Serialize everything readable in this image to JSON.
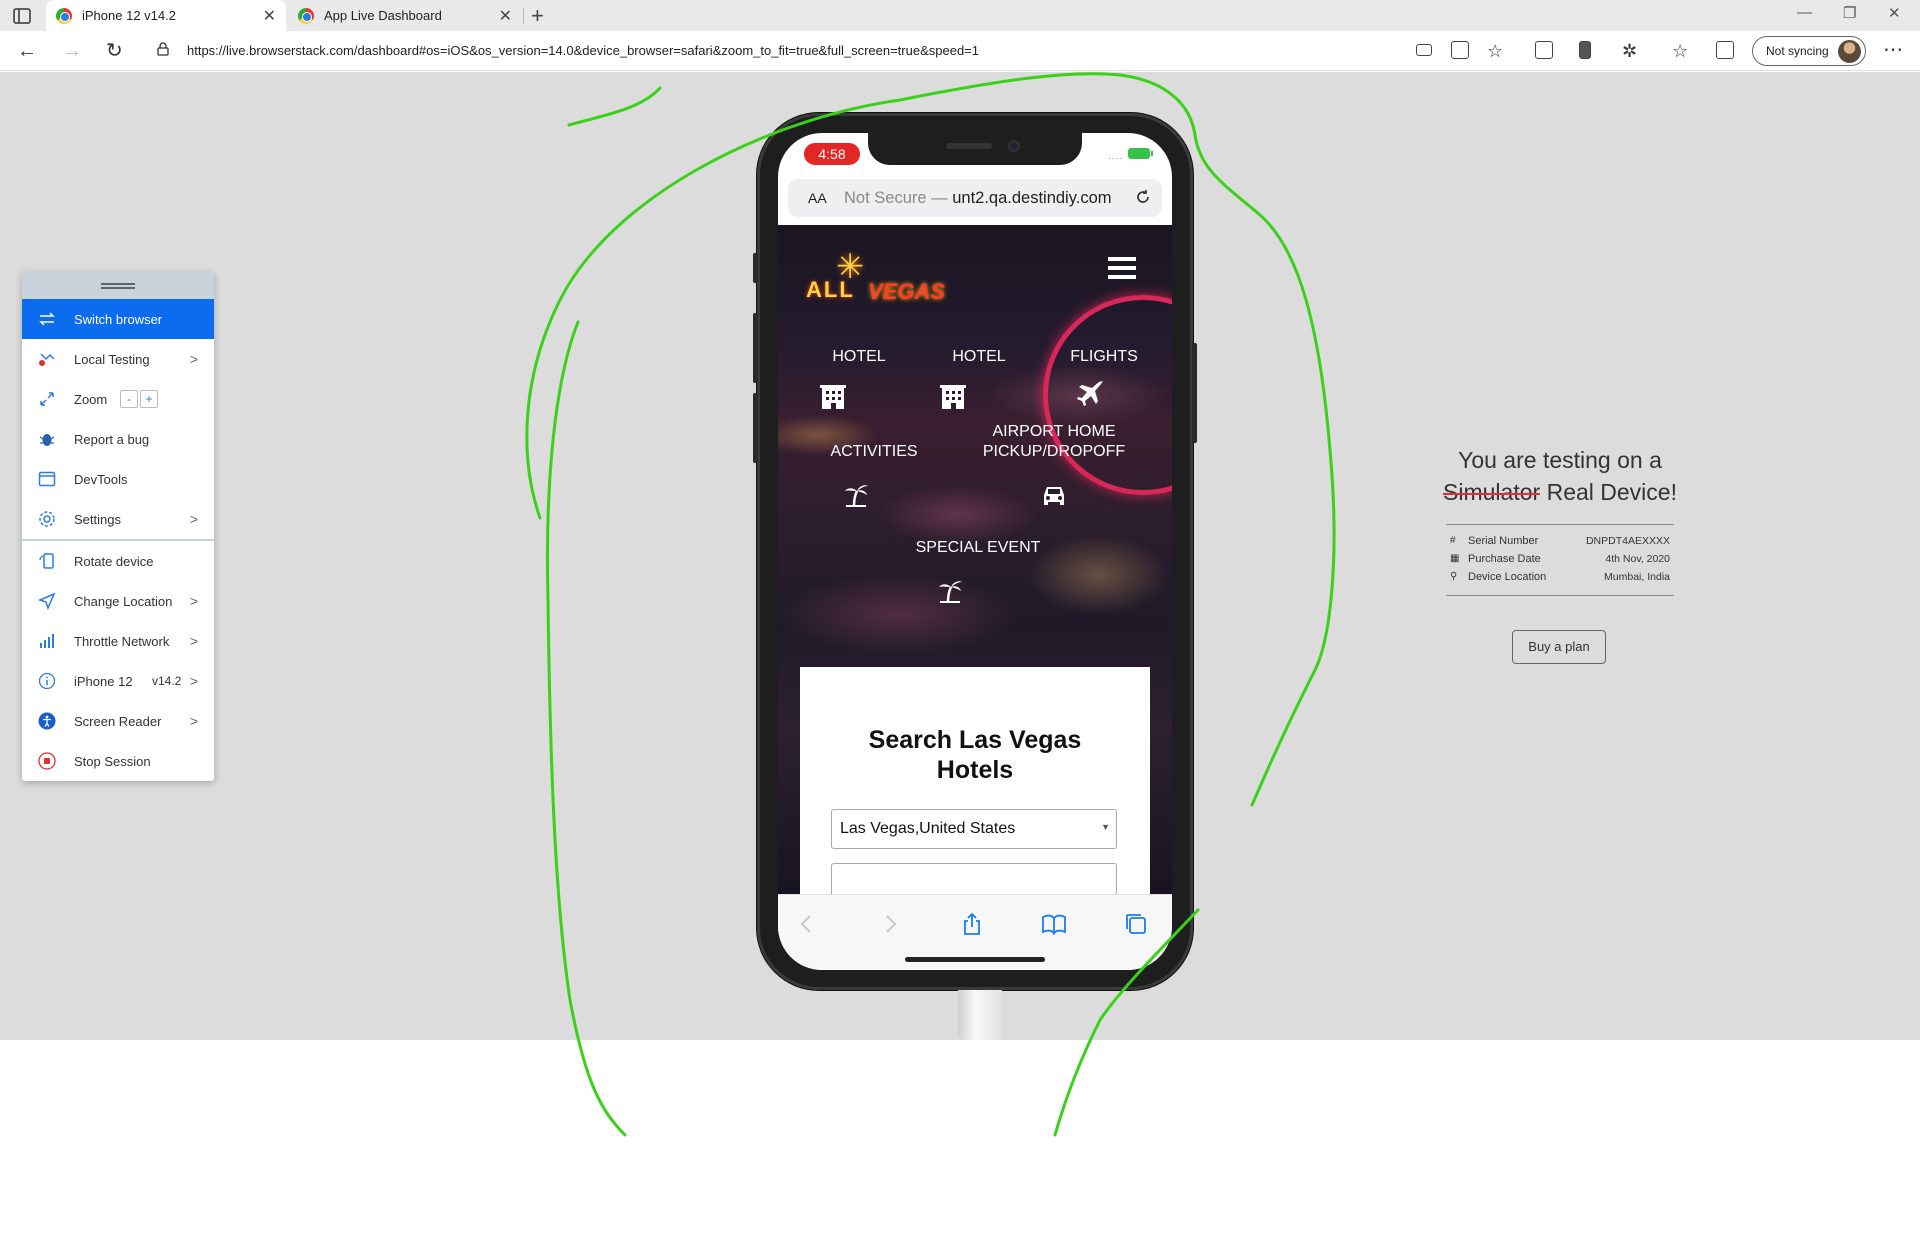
{
  "browser": {
    "tabs": [
      {
        "label": "iPhone 12 v14.2",
        "active": true
      },
      {
        "label": "App Live Dashboard",
        "active": false
      }
    ],
    "url": "https://live.browserstack.com/dashboard#os=iOS&os_version=14.0&device_browser=safari&zoom_to_fit=true&full_screen=true&speed=1",
    "sync_label": "Not syncing"
  },
  "toolbar": {
    "items": [
      {
        "label": "Switch browser",
        "icon": "switch-icon",
        "active": true
      },
      {
        "label": "Local Testing",
        "icon": "local-testing-icon",
        "chevron": ">"
      },
      {
        "label": "Zoom",
        "icon": "expand-icon",
        "minus": "-",
        "plus": "+"
      },
      {
        "label": "Report a bug",
        "icon": "bug-icon"
      },
      {
        "label": "DevTools",
        "icon": "devtools-icon"
      },
      {
        "label": "Settings",
        "icon": "gear-icon",
        "chevron": ">"
      },
      {
        "label": "Rotate device",
        "icon": "rotate-icon"
      },
      {
        "label": "Change Location",
        "icon": "location-arrow-icon",
        "chevron": ">"
      },
      {
        "label": "Throttle Network",
        "icon": "signal-bars-icon",
        "chevron": ">"
      },
      {
        "label": "iPhone 12",
        "version": "v14.2",
        "icon": "info-icon",
        "chevron": ">"
      },
      {
        "label": "Screen Reader",
        "icon": "accessibility-icon",
        "chevron": ">"
      },
      {
        "label": "Stop Session",
        "icon": "stop-icon"
      }
    ]
  },
  "device": {
    "time": "4:58",
    "signal": "....",
    "safari": {
      "aa": "AA",
      "not_secure": "Not Secure —",
      "domain": "unt2.qa.destindiy.com"
    },
    "site": {
      "logo_star": "✳",
      "logo_all": "ALL",
      "logo_vegas": "VEGAS",
      "services": {
        "hotel1": "HOTEL",
        "hotel2": "HOTEL",
        "flights": "FLIGHTS",
        "activities": "ACTIVITIES",
        "airport_line1": "AIRPORT HOME",
        "airport_line2": "PICKUP/DROPOFF",
        "special_event": "SPECIAL EVENT"
      },
      "search_title_line1": "Search Las Vegas",
      "search_title_line2": "Hotels",
      "location_value": "Las Vegas,United States"
    }
  },
  "info": {
    "title_prefix": "You are testing on a",
    "struck_word": "Simulator",
    "title_suffix": "Real Device!",
    "rows": [
      {
        "key": "#",
        "label": "Serial Number",
        "value": "DNPDT4AEXXXX"
      },
      {
        "key": "▦",
        "label": "Purchase Date",
        "value": "4th Nov, 2020"
      },
      {
        "key": "⚲",
        "label": "Device Location",
        "value": "Mumbai, India"
      }
    ],
    "buy_label": "Buy a plan"
  },
  "colors": {
    "accent": "#0b6cf0",
    "scribble": "#3ad11a",
    "time_pill": "#e32626",
    "stop": "#e03030"
  }
}
